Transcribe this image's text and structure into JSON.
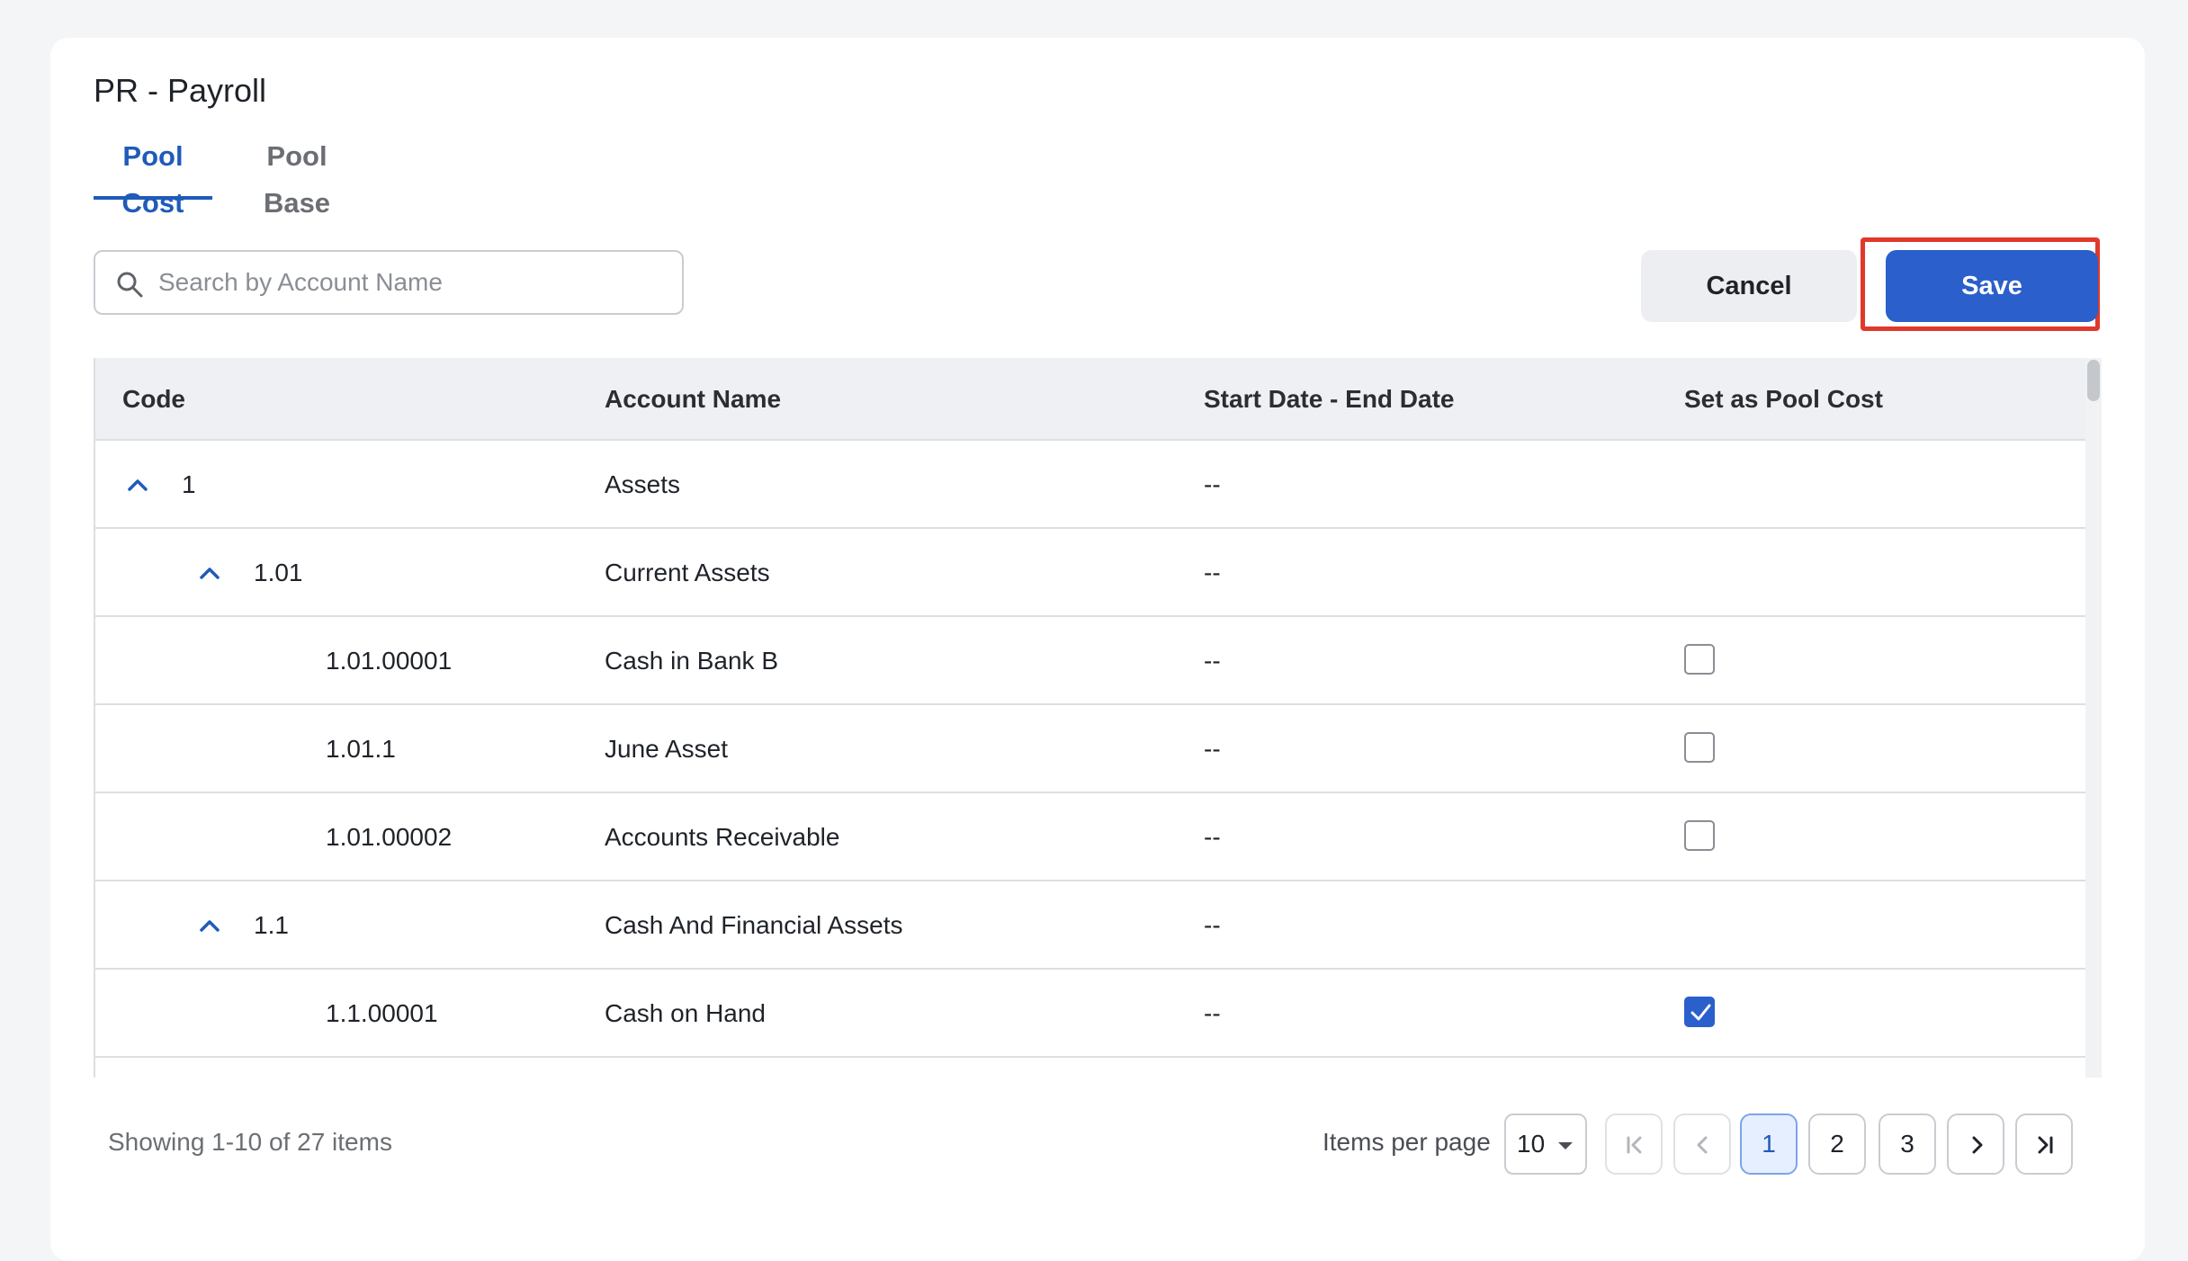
{
  "page": {
    "title": "PR - Payroll",
    "tabs": [
      {
        "label": "Pool Cost",
        "active": true
      },
      {
        "label": "Pool Base",
        "active": false
      }
    ]
  },
  "toolbar": {
    "search_placeholder": "Search by Account Name",
    "search_value": "",
    "cancel_label": "Cancel",
    "save_label": "Save"
  },
  "table": {
    "columns": [
      "Code",
      "Account Name",
      "Start Date - End Date",
      "Set as Pool Cost"
    ],
    "rows": [
      {
        "code": "1",
        "account": "Assets",
        "dates": "--",
        "level": 0,
        "expandable": true,
        "checkbox": null
      },
      {
        "code": "1.01",
        "account": "Current Assets",
        "dates": "--",
        "level": 1,
        "expandable": true,
        "checkbox": null
      },
      {
        "code": "1.01.00001",
        "account": "Cash in Bank B",
        "dates": "--",
        "level": 2,
        "expandable": false,
        "checkbox": false
      },
      {
        "code": "1.01.1",
        "account": "June Asset",
        "dates": "--",
        "level": 2,
        "expandable": false,
        "checkbox": false
      },
      {
        "code": "1.01.00002",
        "account": "Accounts Receivable",
        "dates": "--",
        "level": 2,
        "expandable": false,
        "checkbox": false
      },
      {
        "code": "1.1",
        "account": "Cash And Financial Assets",
        "dates": "--",
        "level": 1,
        "expandable": true,
        "checkbox": null
      },
      {
        "code": "1.1.00001",
        "account": "Cash on Hand",
        "dates": "--",
        "level": 2,
        "expandable": false,
        "checkbox": true
      }
    ]
  },
  "pagination": {
    "showing_text": "Showing 1-10 of 27 items",
    "items_per_page_label": "Items per page",
    "items_per_page_value": "10",
    "pages": [
      "1",
      "2",
      "3"
    ],
    "current_page": "1"
  },
  "colors": {
    "accent": "#2b5fcb",
    "active_tab": "#1f5bb9",
    "highlight": "#e0392b"
  },
  "icons": {
    "search": "search-icon",
    "expand": "chevron-up-icon",
    "first": "first-page-icon",
    "prev": "chevron-left-icon",
    "next": "chevron-right-icon",
    "last": "last-page-icon",
    "dropdown": "caret-down-icon"
  }
}
